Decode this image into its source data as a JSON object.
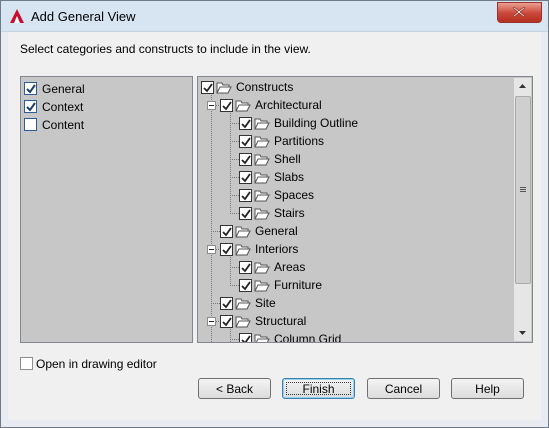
{
  "window": {
    "title": "Add General View",
    "app_icon": "autocad-a-icon",
    "close_icon": "close-x-icon",
    "accent": "#d7e4f2",
    "close_color": "#c9463a"
  },
  "instruction": "Select categories and constructs to include in the view.",
  "categories": [
    {
      "label": "General",
      "checked": true
    },
    {
      "label": "Context",
      "checked": true
    },
    {
      "label": "Content",
      "checked": false
    }
  ],
  "tree": {
    "root": "Constructs",
    "items": [
      {
        "label": "Architectural",
        "level": 1,
        "expandable": true
      },
      {
        "label": "Building Outline",
        "level": 2
      },
      {
        "label": "Partitions",
        "level": 2
      },
      {
        "label": "Shell",
        "level": 2
      },
      {
        "label": "Slabs",
        "level": 2
      },
      {
        "label": "Spaces",
        "level": 2
      },
      {
        "label": "Stairs",
        "level": 2
      },
      {
        "label": "General",
        "level": 1
      },
      {
        "label": "Interiors",
        "level": 1,
        "expandable": true
      },
      {
        "label": "Areas",
        "level": 2
      },
      {
        "label": "Furniture",
        "level": 2
      },
      {
        "label": "Site",
        "level": 1
      },
      {
        "label": "Structural",
        "level": 1,
        "expandable": true
      },
      {
        "label": "Column Grid",
        "level": 2
      }
    ]
  },
  "open_in_editor": {
    "label": "Open in drawing editor",
    "checked": false
  },
  "buttons": {
    "back": "< Back",
    "finish": "Finish",
    "cancel": "Cancel",
    "help": "Help"
  }
}
